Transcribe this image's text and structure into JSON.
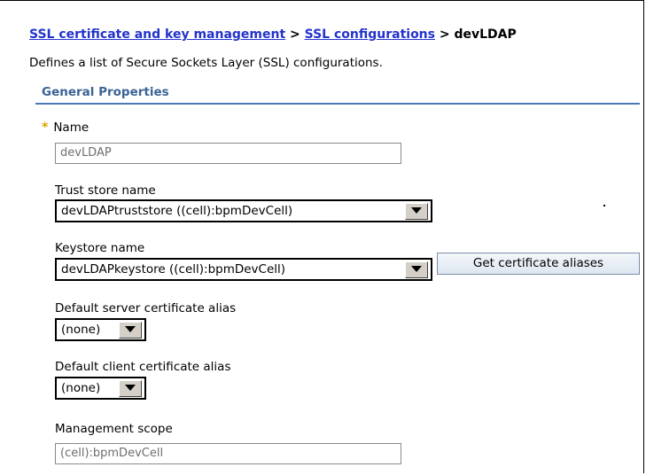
{
  "breadcrumb": {
    "link1": "SSL certificate and key management",
    "separator": ">",
    "link2": "SSL configurations",
    "current": "devLDAP"
  },
  "description": "Defines a list of Secure Sockets Layer (SSL) configurations.",
  "section": {
    "title": "General Properties"
  },
  "fields": {
    "name": {
      "required_marker": "*",
      "label": "Name",
      "value": "devLDAP"
    },
    "trust_store": {
      "label": "Trust store name",
      "value": "devLDAPtruststore ((cell):bpmDevCell)"
    },
    "keystore": {
      "label": "Keystore name",
      "value": "devLDAPkeystore ((cell):bpmDevCell)",
      "button_label": "Get certificate aliases"
    },
    "server_alias": {
      "label": "Default server certificate alias",
      "value": "(none)"
    },
    "client_alias": {
      "label": "Default client certificate alias",
      "value": "(none)"
    },
    "scope": {
      "label": "Management scope",
      "value": "(cell):bpmDevCell"
    }
  },
  "colors": {
    "link": "#2233cc",
    "section_title": "#3a6396",
    "required": "#d9a300",
    "rule": "#4a7ab6"
  },
  "icons": {
    "dropdown": "chevron-down-icon",
    "required": "asterisk-icon"
  }
}
